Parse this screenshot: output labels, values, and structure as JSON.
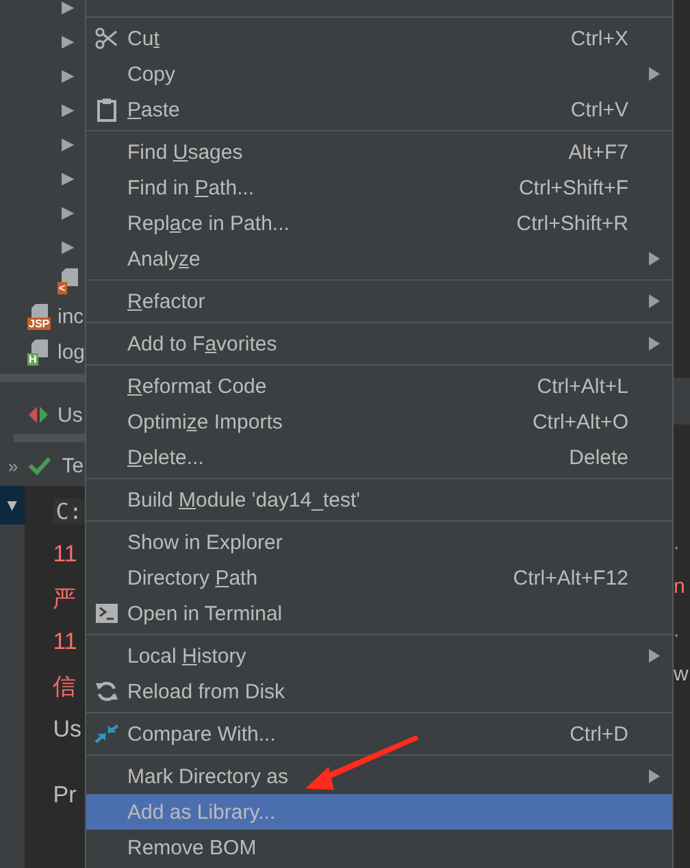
{
  "project_tree": {
    "rows": [
      {
        "toggle": "▶"
      },
      {
        "toggle": "▶"
      },
      {
        "toggle": "▶"
      },
      {
        "toggle": "▶"
      },
      {
        "toggle": "▶"
      },
      {
        "toggle": "▶"
      },
      {
        "toggle": "▶"
      },
      {
        "toggle": "▶"
      }
    ],
    "files": [
      {
        "kind": "web",
        "badge": "<"
      },
      {
        "kind": "jsp",
        "badge": "JSP",
        "name": "inc"
      },
      {
        "kind": "html",
        "badge": "H",
        "name": "log"
      }
    ]
  },
  "run_tab": {
    "label": "Us"
  },
  "run_bar": {
    "more": "»",
    "label": "Te"
  },
  "console": {
    "collapse": "▼",
    "lines": [
      {
        "kind": "command",
        "text": "C:"
      },
      {
        "kind": "error",
        "text": "11"
      },
      {
        "kind": "error",
        "text": "严"
      },
      {
        "kind": "error",
        "text": "11"
      },
      {
        "kind": "error",
        "text": "信"
      },
      {
        "kind": "output",
        "text": "Us"
      },
      {
        "kind": "prompt",
        "text": "Pr"
      }
    ]
  },
  "console_right": [
    {
      "kind": "error",
      "text": "."
    },
    {
      "kind": "error",
      "text": "n"
    },
    {
      "kind": "error",
      "text": "."
    },
    {
      "kind": "output",
      "text": "w"
    }
  ],
  "menu": {
    "groups": [
      {
        "items": [
          {
            "before": "Cu",
            "key": "t",
            "shortcut": "Ctrl+X",
            "kind": "scissors",
            "submenu": false,
            "selected": false
          },
          {
            "label": "Copy",
            "submenu": true,
            "selected": false
          },
          {
            "key": "P",
            "after": "aste",
            "shortcut": "Ctrl+V",
            "kind": "clipboard",
            "submenu": false,
            "selected": false
          }
        ]
      },
      {
        "items": [
          {
            "before": "Find ",
            "key": "U",
            "after": "sages",
            "shortcut": "Alt+F7",
            "submenu": false,
            "selected": false
          },
          {
            "before": "Find in ",
            "key": "P",
            "after": "ath...",
            "shortcut": "Ctrl+Shift+F",
            "submenu": false,
            "selected": false
          },
          {
            "before": "Repl",
            "key": "a",
            "after": "ce in Path...",
            "shortcut": "Ctrl+Shift+R",
            "submenu": false,
            "selected": false
          },
          {
            "before": "Analy",
            "key": "z",
            "after": "e",
            "submenu": true,
            "selected": false
          }
        ]
      },
      {
        "items": [
          {
            "key": "R",
            "after": "efactor",
            "submenu": true,
            "selected": false
          }
        ]
      },
      {
        "items": [
          {
            "before": "Add to F",
            "key": "a",
            "after": "vorites",
            "submenu": true,
            "selected": false
          }
        ]
      },
      {
        "items": [
          {
            "key": "R",
            "after": "eformat Code",
            "shortcut": "Ctrl+Alt+L",
            "submenu": false,
            "selected": false
          },
          {
            "before": "Optimi",
            "key": "z",
            "after": "e Imports",
            "shortcut": "Ctrl+Alt+O",
            "submenu": false,
            "selected": false
          },
          {
            "key": "D",
            "after": "elete...",
            "shortcut": "Delete",
            "submenu": false,
            "selected": false
          }
        ]
      },
      {
        "items": [
          {
            "before": "Build ",
            "key": "M",
            "after": "odule 'day14_test'",
            "submenu": false,
            "selected": false
          }
        ]
      },
      {
        "items": [
          {
            "label": "Show in Explorer",
            "submenu": false,
            "selected": false
          },
          {
            "before": "Directory ",
            "key": "P",
            "after": "ath",
            "shortcut": "Ctrl+Alt+F12",
            "submenu": false,
            "selected": false
          },
          {
            "label": "Open in Terminal",
            "kind": "terminal",
            "submenu": false,
            "selected": false
          }
        ]
      },
      {
        "items": [
          {
            "before": "Local ",
            "key": "H",
            "after": "istory",
            "submenu": true,
            "selected": false
          },
          {
            "label": "Reload from Disk",
            "kind": "reload",
            "submenu": false,
            "selected": false
          }
        ]
      },
      {
        "items": [
          {
            "label": "Compare With...",
            "shortcut": "Ctrl+D",
            "kind": "compare",
            "submenu": false,
            "selected": false
          }
        ]
      },
      {
        "items": [
          {
            "label": "Mark Directory as",
            "submenu": true,
            "selected": false
          },
          {
            "label": "Add as Library...",
            "submenu": false,
            "selected": true
          },
          {
            "label": "Remove BOM",
            "submenu": false,
            "selected": false
          }
        ]
      }
    ]
  }
}
